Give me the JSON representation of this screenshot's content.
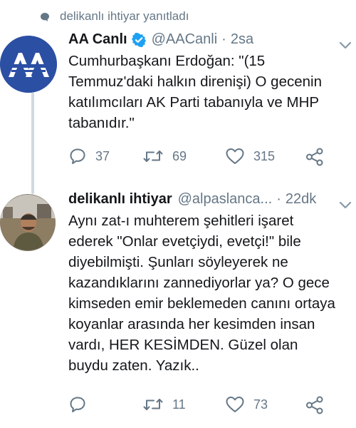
{
  "context": {
    "text": "delikanlı ihtiyar yanıtladı",
    "icon": "reply-bubble-icon"
  },
  "tweets": [
    {
      "name": "AA Canlı",
      "verified": true,
      "handle": "@AACanli",
      "separator": "·",
      "time": "2sa",
      "text": "Cumhurbaşkanı Erdoğan: \"(15 Temmuz'daki halkın direnişi) O gecenin katılımcıları AK Parti tabanıyla ve MHP tabanıdır.\"",
      "avatar_text": "AA",
      "avatar_color": "#2b4fa3",
      "replies": "37",
      "retweets": "69",
      "likes": "315"
    },
    {
      "name": "delikanlı ihtiyar",
      "verified": false,
      "handle": "@alpaslanca...",
      "separator": "·",
      "time": "22dk",
      "text": "Aynı zat-ı muhterem şehitleri işaret ederek \"Onlar evetçiydi, evetçi!\" bile diyebilmişti. Şunları söyleyerek ne kazandıklarını zannediyorlar ya? O gece kimseden emir beklemeden canını ortaya koyanlar arasında her kesimden insan vardı, HER KESİMDEN. Güzel olan buydu zaten. Yazık..",
      "replies": "",
      "retweets": "11",
      "likes": "73"
    }
  ],
  "colors": {
    "text": "#14171a",
    "muted": "#657786",
    "verified": "#1da1f2",
    "thread_line": "#cfd9de"
  }
}
